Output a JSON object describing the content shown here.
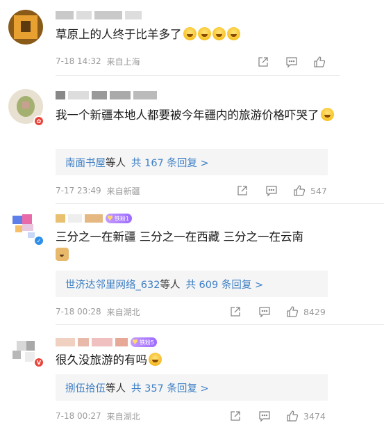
{
  "comments": [
    {
      "text": "草原上的人终于比羊多了",
      "emojis": [
        "laugh-cry",
        "laugh-cry",
        "laugh-cry",
        "laugh-cry"
      ],
      "time": "7-18 14:32",
      "location": "来自上海",
      "like_count": ""
    },
    {
      "text": "我一个新疆本地人都要被今年疆内的旅游价格吓哭了",
      "emojis": [
        "laugh-cry"
      ],
      "time": "7-17 23:49",
      "location": "来自新疆",
      "reply_user": "南面书屋",
      "reply_middle": "等人",
      "reply_total": "共 167 条回复 >",
      "like_count": "547"
    },
    {
      "text": "三分之一在新疆 三分之一在西藏 三分之一在云南",
      "emojis": [
        "doge"
      ],
      "time": "7-18 00:28",
      "location": "来自湖北",
      "badge": "铁粉1",
      "reply_user": "世济达邻里网络_632",
      "reply_middle": "等人",
      "reply_total": "共 609 条回复 >",
      "like_count": "8429"
    },
    {
      "text": "很久没旅游的有吗",
      "emojis": [
        "crying"
      ],
      "time": "7-18 00:27",
      "location": "来自湖北",
      "badge": "铁粉5",
      "reply_user": "捌伍拾伍",
      "reply_middle": "等人",
      "reply_total": "共 357 条回复 >",
      "like_count": "3474"
    }
  ]
}
